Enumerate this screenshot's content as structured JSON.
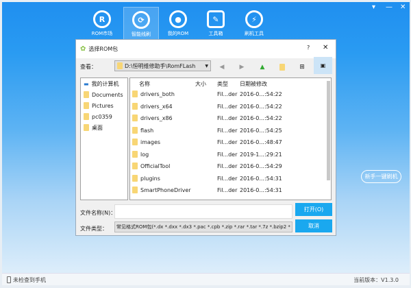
{
  "window": {
    "controls": [
      "▾",
      "—",
      "✕"
    ]
  },
  "nav": [
    {
      "label": "ROM市场",
      "icon": "R"
    },
    {
      "label": "智能线刷",
      "icon": "⟳"
    },
    {
      "label": "我的ROM",
      "icon": "●"
    },
    {
      "label": "工具箱",
      "icon": "✎"
    },
    {
      "label": "刷机工具",
      "icon": "⚡"
    }
  ],
  "dialog": {
    "title": "选择ROM包",
    "help": "?",
    "close": "✕",
    "look_in_label": "查看：",
    "path": "D:\\恒明维修助手\\RomFLash",
    "places": [
      "我的计算机",
      "Documents",
      "Pictures",
      "pc0359",
      "桌面"
    ],
    "columns": [
      "名称",
      "大小",
      "类型",
      "日期被修改"
    ],
    "files": [
      {
        "name": "drivers_both",
        "type": "Fil...der",
        "date": "2016-0...:54:22"
      },
      {
        "name": "drivers_x64",
        "type": "Fil...der",
        "date": "2016-0...:54:22"
      },
      {
        "name": "drivers_x86",
        "type": "Fil...der",
        "date": "2016-0...:54:22"
      },
      {
        "name": "flash",
        "type": "Fil...der",
        "date": "2016-0...:54:25"
      },
      {
        "name": "images",
        "type": "Fil...der",
        "date": "2016-0...:48:47"
      },
      {
        "name": "log",
        "type": "Fil...der",
        "date": "2019-1...:29:21"
      },
      {
        "name": "OfficialTool",
        "type": "Fil...der",
        "date": "2016-0...:54:29"
      },
      {
        "name": "plugins",
        "type": "Fil...der",
        "date": "2016-0...:54:31"
      },
      {
        "name": "SmartPhoneDriver",
        "type": "Fil...der",
        "date": "2016-0...:54:31"
      }
    ],
    "filename_label": "文件名称(N)：",
    "filename_value": "",
    "filetype_label": "文件类型：",
    "filetype_value": "常见格式ROM包(*.dx *.dxx *.dx3 *.pac *.cpb *.zip *.rar *.tar *.7z *.bzip2 *",
    "open": "打开(O)",
    "cancel": "取消"
  },
  "quick_flash": "新手一键刷机",
  "status": {
    "phone": "未检查到手机",
    "version": "当前版本：V1.3.0"
  }
}
